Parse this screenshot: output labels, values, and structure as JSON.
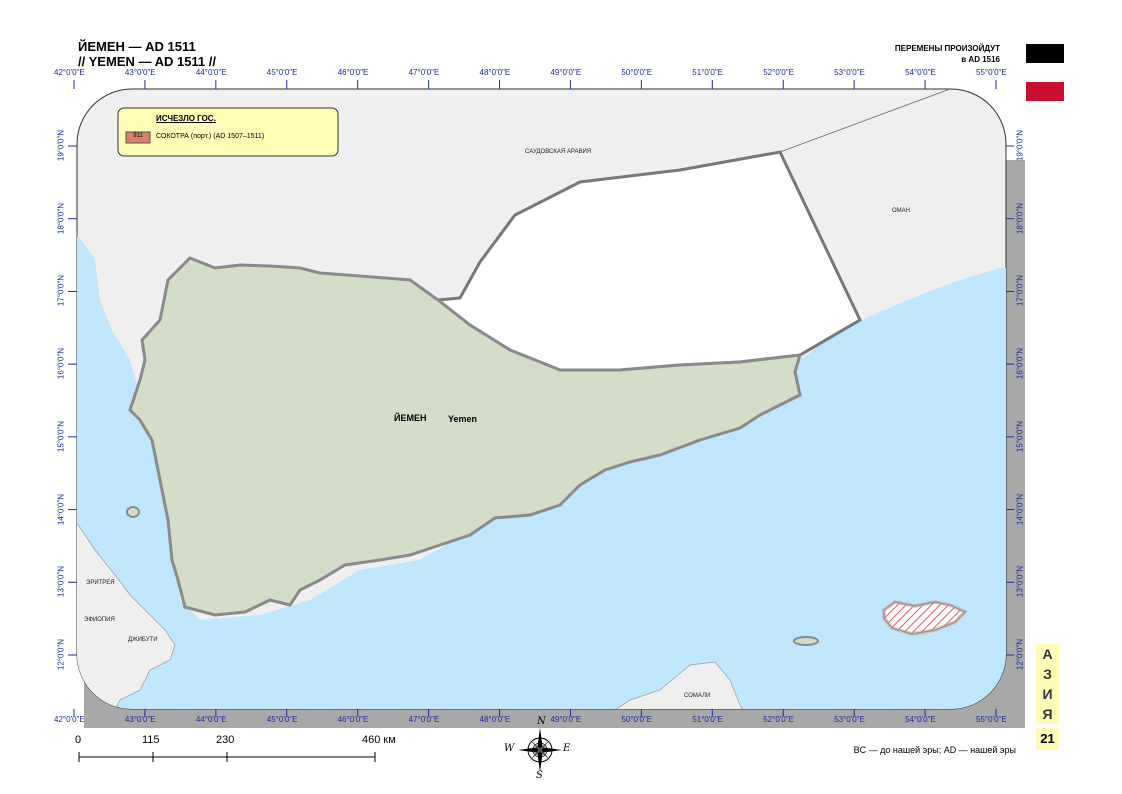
{
  "header": {
    "title_ru": "ЙЕМЕН — AD 1511",
    "title_en": "// YEMEN — AD 1511 //",
    "changes_line1": "ПЕРЕМЕНЫ ПРОИЗОЙДУТ",
    "changes_line2": "в AD 1516"
  },
  "flag": {
    "colors": [
      "#000000",
      "#ffffff",
      "#c8102e"
    ]
  },
  "grid": {
    "longitudes": [
      "42°0'0\"E",
      "43°0'0\"E",
      "44°0'0\"E",
      "45°0'0\"E",
      "46°0'0\"E",
      "47°0'0\"E",
      "48°0'0\"E",
      "49°0'0\"E",
      "50°0'0\"E",
      "51°0'0\"E",
      "52°0'0\"E",
      "53°0'0\"E",
      "54°0'0\"E",
      "55°0'0\"E"
    ],
    "latitudes": [
      "19°0'0\"N",
      "18°0'0\"N",
      "17°0'0\"N",
      "16°0'0\"N",
      "15°0'0\"N",
      "14°0'0\"N",
      "13°0'0\"N",
      "12°0'0\"N"
    ]
  },
  "legend": {
    "title": "ИСЧЕЗЛО ГОС.",
    "entry_code": "911",
    "entry_label": "СОКОТРА (порт.) (AD 1507–1511)"
  },
  "map": {
    "yemen_ru": "ЙЕМЕН",
    "yemen_en": "Yemen",
    "places": {
      "saudi": "САУДОВСКАЯ АРАВИЯ",
      "oman": "ОМАН",
      "eritrea": "ЭРИТРЕЯ",
      "ethiopia": "ЭФИОПИЯ",
      "djibouti": "ДЖИБУТИ",
      "somalia": "СОМАЛИ"
    },
    "colors": {
      "sea": "#bfe6fa",
      "land": "#efefef",
      "yemen": "#d4ddc8",
      "socotra_hatch": "#d22f2f"
    }
  },
  "side": {
    "region_letters": [
      "А",
      "З",
      "И",
      "Я"
    ],
    "page_number": "21"
  },
  "scale": {
    "labels": [
      "0",
      "115",
      "230",
      "460 км"
    ]
  },
  "compass": {
    "n": "N",
    "s": "S",
    "e": "E",
    "w": "W"
  },
  "footer": {
    "era_note": "BC — до нашей эры; AD — нашей эры"
  }
}
